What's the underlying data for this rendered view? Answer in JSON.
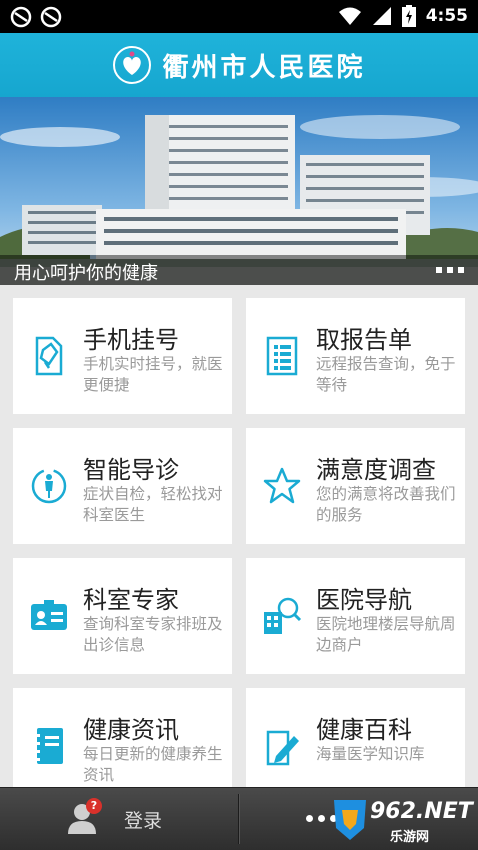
{
  "status_bar": {
    "time": "4:55",
    "icons": [
      "sync-icon",
      "sync-icon",
      "wifi-icon",
      "signal-icon",
      "battery-charging-icon"
    ]
  },
  "header": {
    "title": "衢州市人民医院",
    "logo": "hospital-logo"
  },
  "banner": {
    "caption": "用心呵护你的健康"
  },
  "menu": [
    {
      "title": "手机挂号",
      "desc": "手机实时挂号，就医更便捷",
      "icon": "phone-register-icon"
    },
    {
      "title": "取报告单",
      "desc": "远程报告查询，免于等待",
      "icon": "report-document-icon"
    },
    {
      "title": "智能导诊",
      "desc": "症状自检，轻松找对科室医生",
      "icon": "body-guide-icon"
    },
    {
      "title": "满意度调查",
      "desc": "您的满意将改善我们的服务",
      "icon": "star-icon"
    },
    {
      "title": "科室专家",
      "desc": "查询科室专家排班及出诊信息",
      "icon": "id-card-icon"
    },
    {
      "title": "医院导航",
      "desc": "医院地理楼层导航周边商户",
      "icon": "building-search-icon"
    },
    {
      "title": "健康资讯",
      "desc": "每日更新的健康养生资讯",
      "icon": "notebook-icon"
    },
    {
      "title": "健康百科",
      "desc": "海量医学知识库",
      "icon": "pen-document-icon"
    }
  ],
  "bottom_bar": {
    "login_label": "登录",
    "badge": "?",
    "watermark_num": "962.NET",
    "watermark_sub": "乐游网"
  },
  "colors": {
    "accent": "#1aabd3",
    "card_bg": "#ffffff",
    "page_bg": "#e8e8e8",
    "bottom_bar": "#3a3a3a"
  }
}
